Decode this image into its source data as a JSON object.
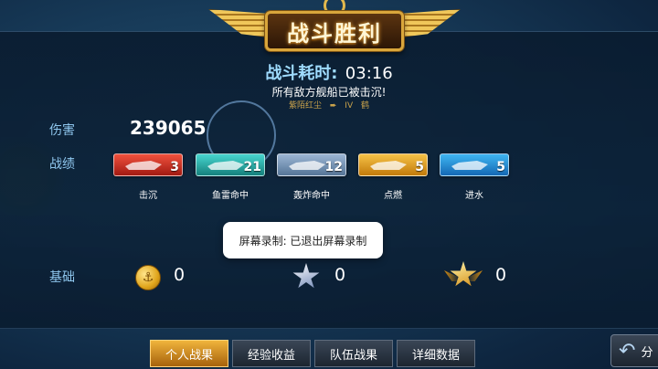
{
  "header": {
    "title": "战斗胜利"
  },
  "battle": {
    "time_label": "战斗耗时:",
    "time_value": "03:16",
    "result_message": "所有敌方舰船已被击沉!",
    "player_name": "紫陌红尘",
    "ship_tier": "IV",
    "ship_name": "鹤"
  },
  "stats": {
    "damage_label": "伤害",
    "damage_value": "239065",
    "record_label": "战绩",
    "records": [
      {
        "label": "击沉",
        "count": "3",
        "color": "#d8362a",
        "icon": "plane-sink-icon"
      },
      {
        "label": "鱼雷命中",
        "count": "21",
        "color": "#2cb3ad",
        "icon": "torpedo-icon"
      },
      {
        "label": "轰炸命中",
        "count": "12",
        "color": "#7894b6",
        "icon": "bomb-icon"
      },
      {
        "label": "点燃",
        "count": "5",
        "color": "#e3a020",
        "icon": "ship-fire-icon"
      },
      {
        "label": "进水",
        "count": "5",
        "color": "#1e8fd6",
        "icon": "flooding-icon"
      }
    ]
  },
  "basic": {
    "label": "基础",
    "coins": "0",
    "silver_exp": "0",
    "gold_exp": "0"
  },
  "toast": {
    "text": "屏幕录制: 已退出屏幕录制"
  },
  "tabs": [
    {
      "label": "个人战果",
      "active": true
    },
    {
      "label": "经验收益",
      "active": false
    },
    {
      "label": "队伍战果",
      "active": false
    },
    {
      "label": "详细数据",
      "active": false
    }
  ],
  "back_button": {
    "label": "分"
  }
}
